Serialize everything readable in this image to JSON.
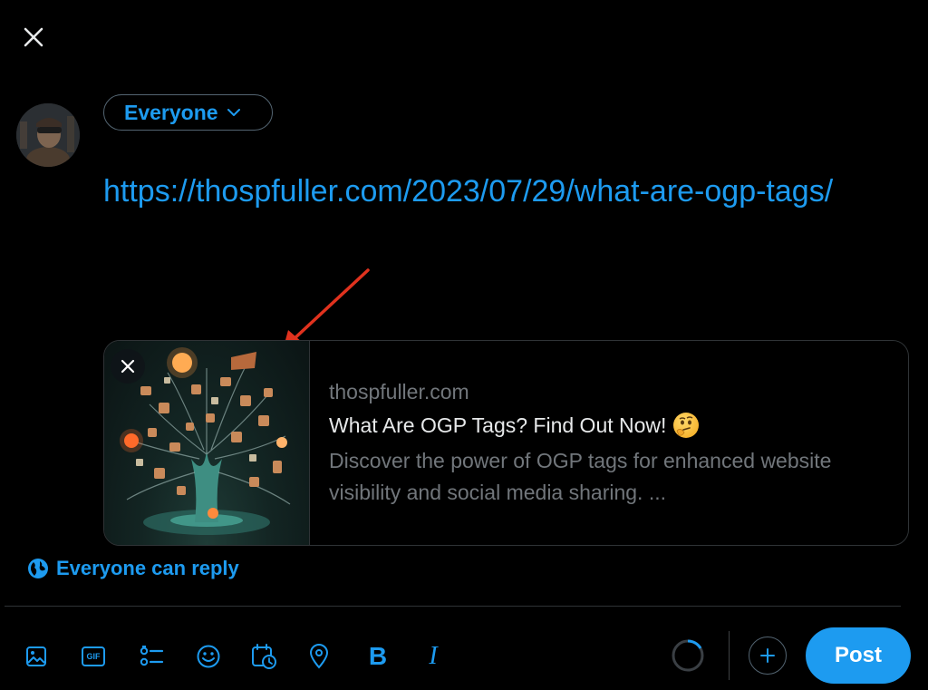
{
  "compose": {
    "audience_label": "Everyone",
    "text": "https://thospfuller.com/2023/07/29/what-are-ogp-tags/"
  },
  "link_card": {
    "domain": "thospfuller.com",
    "title": "What Are OGP Tags? Find Out Now!",
    "title_emoji": "thinking-face",
    "description": "Discover the power of OGP tags for enhanced website visibility and social media sharing. ..."
  },
  "reply_setting": {
    "label": "Everyone can reply",
    "icon": "globe-icon"
  },
  "toolbar": {
    "icons": [
      "image-icon",
      "gif-icon",
      "poll-icon",
      "emoji-icon",
      "schedule-icon",
      "location-icon",
      "bold-icon",
      "italic-icon"
    ],
    "gif_text": "GIF",
    "bold_text": "B",
    "italic_text": "I",
    "post_label": "Post",
    "progress": 0.0
  },
  "colors": {
    "accent": "#1d9bf0",
    "background": "#000000",
    "border": "#2f3336",
    "muted_text": "#71767b",
    "annotation": "#e0321e"
  }
}
